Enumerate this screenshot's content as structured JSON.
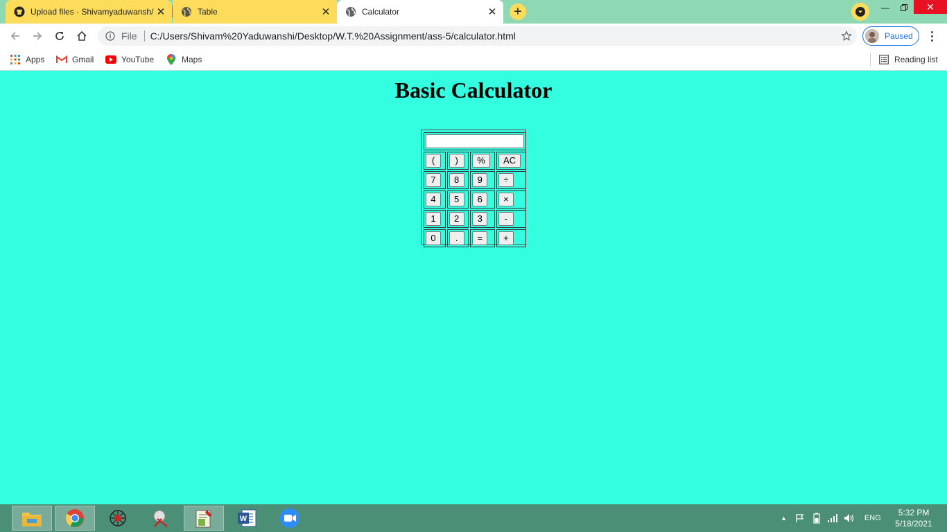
{
  "browser": {
    "tabs": [
      {
        "title": "Upload files · Shivamyaduwansh/",
        "icon": "github-icon"
      },
      {
        "title": "Table",
        "icon": "globe-icon"
      },
      {
        "title": "Calculator",
        "icon": "globe-icon"
      }
    ],
    "address": {
      "scheme": "File",
      "url": "C:/Users/Shivam%20Yaduwanshi/Desktop/W.T.%20Assignment/ass-5/calculator.html"
    },
    "profile_status": "Paused",
    "bookmarks": [
      {
        "label": "Apps",
        "icon": "apps-grid-icon"
      },
      {
        "label": "Gmail",
        "icon": "gmail-icon"
      },
      {
        "label": "YouTube",
        "icon": "youtube-icon"
      },
      {
        "label": "Maps",
        "icon": "maps-pin-icon"
      }
    ],
    "reading_list": "Reading list"
  },
  "page": {
    "title": "Basic Calculator",
    "display_value": "",
    "rows": [
      [
        "(",
        ")",
        "%",
        "AC"
      ],
      [
        "7",
        "8",
        "9",
        "÷"
      ],
      [
        "4",
        "5",
        "6",
        "×"
      ],
      [
        "1",
        "2",
        "3",
        "-"
      ],
      [
        "0",
        ".",
        "=",
        "+"
      ]
    ],
    "background_color": "#33ffe0"
  },
  "taskbar": {
    "apps": [
      "file-explorer-icon",
      "chrome-icon",
      "spider-app-icon",
      "snipping-tool-icon",
      "notepad-plus-icon",
      "word-icon",
      "zoom-icon"
    ],
    "language": "ENG",
    "time": "5:32 PM",
    "date": "5/18/2021"
  }
}
